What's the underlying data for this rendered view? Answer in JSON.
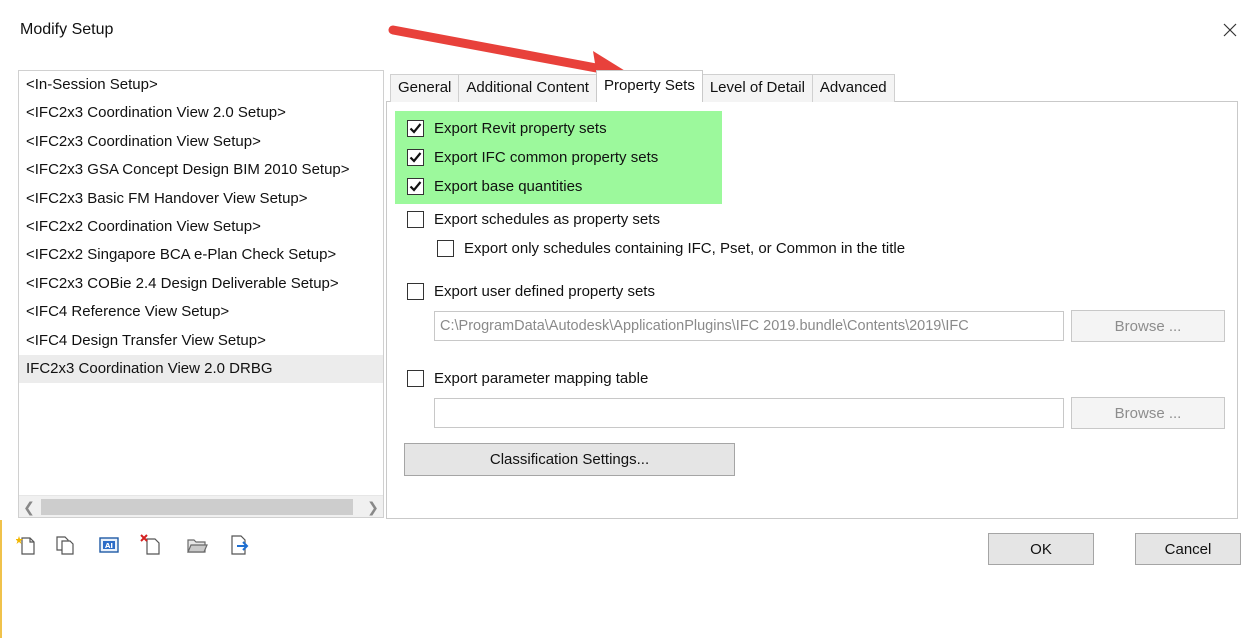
{
  "window": {
    "title": "Modify Setup"
  },
  "setups": [
    "<In-Session Setup>",
    "<IFC2x3 Coordination View 2.0 Setup>",
    "<IFC2x3 Coordination View Setup>",
    "<IFC2x3 GSA Concept Design BIM 2010 Setup>",
    "<IFC2x3 Basic FM Handover View Setup>",
    "<IFC2x2 Coordination View Setup>",
    "<IFC2x2 Singapore BCA e-Plan Check Setup>",
    "<IFC2x3 COBie 2.4 Design Deliverable Setup>",
    "<IFC4 Reference View Setup>",
    "<IFC4 Design Transfer View Setup>",
    "IFC2x3 Coordination View 2.0 DRBG"
  ],
  "selected_setup": "IFC2x3 Coordination View 2.0 DRBG",
  "tabs": [
    "General",
    "Additional Content",
    "Property Sets",
    "Level of Detail",
    "Advanced"
  ],
  "active_tab": "Property Sets",
  "options": {
    "export_revit_psets": {
      "label": "Export Revit property sets",
      "checked": true
    },
    "export_ifc_common": {
      "label": "Export IFC common property sets",
      "checked": true
    },
    "export_base_quantities": {
      "label": "Export base quantities",
      "checked": true
    },
    "export_schedules": {
      "label": "Export schedules as property sets",
      "checked": false
    },
    "export_only_schedules": {
      "label": "Export only schedules containing IFC, Pset, or Common in the title",
      "checked": false
    },
    "export_user_defined": {
      "label": "Export user defined property sets",
      "checked": false
    },
    "export_param_mapping": {
      "label": "Export parameter mapping table",
      "checked": false
    }
  },
  "user_defined_path": "C:\\ProgramData\\Autodesk\\ApplicationPlugins\\IFC 2019.bundle\\Contents\\2019\\IFC",
  "param_mapping_path": "",
  "browse_label": "Browse ...",
  "classification_label": "Classification Settings...",
  "ok_label": "OK",
  "cancel_label": "Cancel",
  "toolbar_icons": [
    "new-setup-icon",
    "duplicate-setup-icon",
    "rename-setup-icon",
    "delete-setup-icon",
    "import-setup-icon",
    "export-setup-icon"
  ],
  "colors": {
    "highlight": "#9cf99c",
    "annotation_arrow": "#e8413b"
  }
}
